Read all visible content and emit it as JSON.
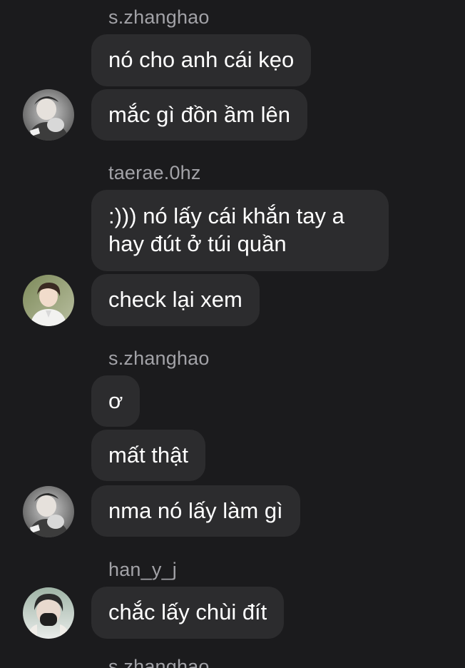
{
  "messages": [
    {
      "sender": "s.zhanghao",
      "bubbles": [
        "nó cho anh cái kẹo",
        "mắc gì đồn ầm lên"
      ]
    },
    {
      "sender": "taerae.0hz",
      "bubbles": [
        ":))) nó lấy cái khắn tay a hay đút ở túi quần",
        "check lại xem"
      ]
    },
    {
      "sender": "s.zhanghao",
      "bubbles": [
        "ơ",
        "mất thật",
        "nma nó lấy làm gì"
      ]
    },
    {
      "sender": "han_y_j",
      "bubbles": [
        "chắc lấy chùi đít"
      ]
    },
    {
      "sender": "s.zhanghao",
      "bubbles": []
    }
  ],
  "avatars": {
    "zhanghao": "avatar-photo-zhanghao",
    "taerae": "avatar-photo-taerae",
    "han_y_j": "avatar-photo-han"
  }
}
